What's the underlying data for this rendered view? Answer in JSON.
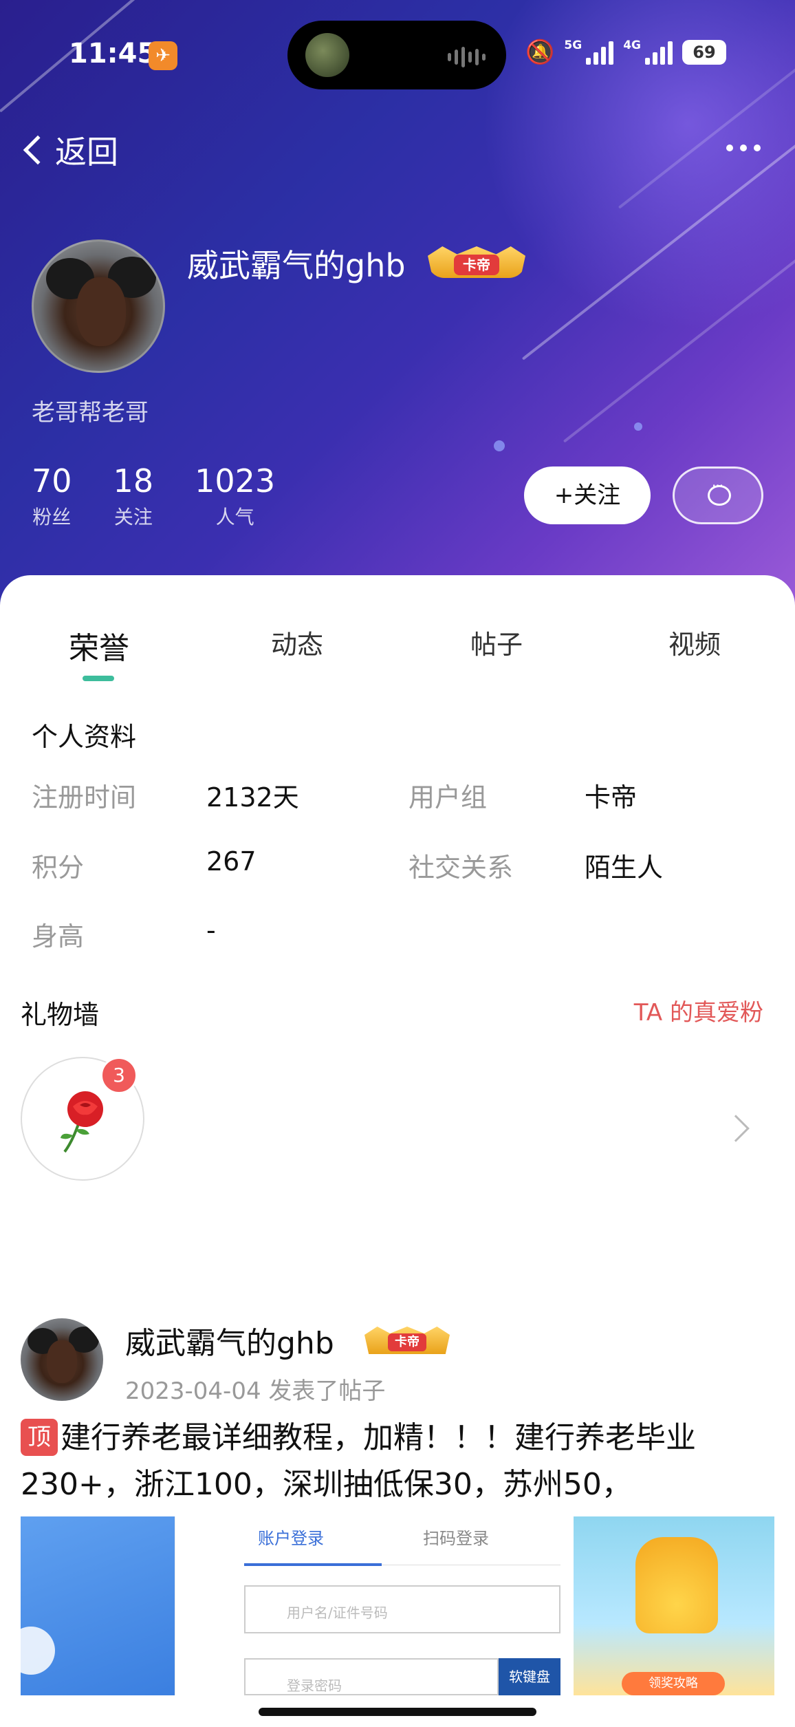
{
  "status_bar": {
    "time": "11:45",
    "network_5g": "5G",
    "network_4g": "4G",
    "battery": "69",
    "app_icon": "app-badge-icon"
  },
  "nav": {
    "back_label": "返回",
    "more_icon": "more-icon"
  },
  "profile": {
    "username": "威武霸气的ghb",
    "vip_label": "卡帝",
    "bio": "老哥帮老哥",
    "stats": [
      {
        "value": "70",
        "label": "粉丝"
      },
      {
        "value": "18",
        "label": "关注"
      },
      {
        "value": "1023",
        "label": "人气"
      }
    ],
    "follow_label": "+关注",
    "message_icon": "chat-bubble-icon"
  },
  "tabs": [
    {
      "label": "荣誉",
      "active": true
    },
    {
      "label": "动态",
      "active": false
    },
    {
      "label": "帖子",
      "active": false
    },
    {
      "label": "视频",
      "active": false
    }
  ],
  "personal_info": {
    "title": "个人资料",
    "rows": [
      {
        "label": "注册时间",
        "value": "2132天"
      },
      {
        "label": "用户组",
        "value": "卡帝"
      },
      {
        "label": "积分",
        "value": "267"
      },
      {
        "label": "社交关系",
        "value": "陌生人"
      },
      {
        "label": "身高",
        "value": "-"
      }
    ]
  },
  "gift_wall": {
    "title": "礼物墙",
    "link": "TA 的真爱粉",
    "gift_icon": "rose-icon",
    "gift_count": "3"
  },
  "post": {
    "author": "威武霸气的ghb",
    "vip_label": "卡帝",
    "meta": "2023-04-04  发表了帖子",
    "pin_label": "顶",
    "title": "建行养老最详细教程，加精！！！建行养老毕业230+，浙江100，深圳抽低保30，苏州50，",
    "image2": {
      "tab_account": "账户登录",
      "tab_qr": "扫码登录",
      "username_placeholder": "用户名/证件号码",
      "password_placeholder": "登录密码",
      "keyboard_button": "软键盘"
    },
    "image3": {
      "button": "领奖攻略"
    }
  },
  "colors": {
    "accent": "#3dbd9c",
    "link_red": "#e25858",
    "header_gradient_start": "#2a1f8e",
    "header_gradient_end": "#9a5ad8"
  }
}
